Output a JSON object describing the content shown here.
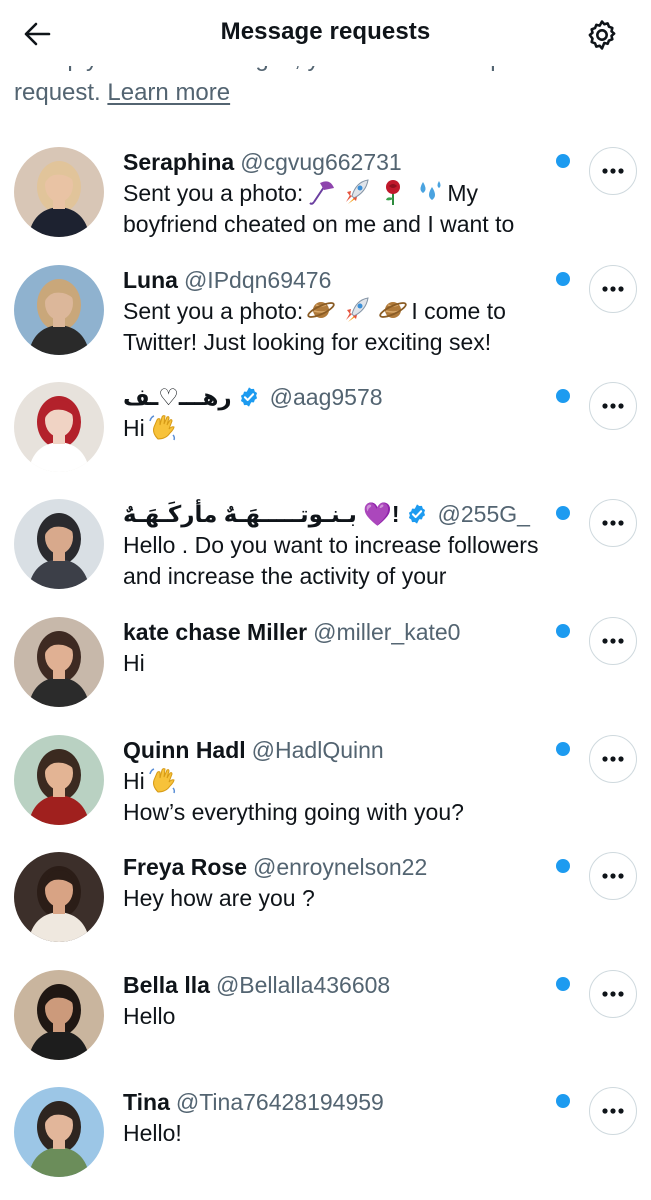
{
  "header": {
    "title": "Message requests",
    "back_icon": "arrow-left-icon",
    "settings_icon": "gear-icon"
  },
  "intro": {
    "line_cut": "To reply to their messages, you need to accept the",
    "line2": "request.",
    "learn_more": "Learn more"
  },
  "colors": {
    "accent": "#1d9bf0",
    "secondary_text": "#536471",
    "border": "#cfd9de"
  },
  "requests": [
    {
      "name": "Seraphina",
      "handle": "@cgvug662731",
      "verified": false,
      "unread": true,
      "msg1": "Sent you a photo:",
      "emojis": [
        "umbrella-emoji",
        "rocket-emoji",
        "rose-emoji",
        "sweat-droplets-emoji"
      ],
      "msg1_tail": "My",
      "msg2": "boyfriend cheated on me and I want to"
    },
    {
      "name": "Luna",
      "handle": "@IPdqn69476",
      "verified": false,
      "unread": true,
      "msg1": "Sent you a photo:",
      "emojis": [
        "ringed-planet-emoji",
        "rocket-emoji",
        "ringed-planet-emoji"
      ],
      "msg1_tail": "I come to",
      "msg2": "Twitter! Just looking for exciting sex!"
    },
    {
      "name": "رهـــ♡ـف",
      "handle": "@aag9578",
      "verified": true,
      "unread": true,
      "msg1": "Hi",
      "emojis": [
        "waving-hand-emoji"
      ]
    },
    {
      "name": "!💜 بـنـوتـــــهَـهٌ مأركَـهَـهٌ",
      "handle": "@255G_",
      "verified": true,
      "unread": true,
      "msg1": "Hello . Do you want to increase followers",
      "msg2": "and increase the activity of your"
    },
    {
      "name": "kate chase Miller",
      "handle": "@miller_kate0",
      "verified": false,
      "unread": true,
      "msg1": "Hi"
    },
    {
      "name": "Quinn Hadl",
      "handle": "@HadlQuinn",
      "verified": false,
      "unread": true,
      "msg1": "Hi",
      "emojis": [
        "waving-hand-emoji"
      ],
      "msg2": "How’s everything going with you?"
    },
    {
      "name": "Freya Rose",
      "handle": "@enroynelson22",
      "verified": false,
      "unread": true,
      "msg1": "Hey how are you ?"
    },
    {
      "name": "Bella lla",
      "handle": "@Bellalla436608",
      "verified": false,
      "unread": true,
      "msg1": "Hello"
    },
    {
      "name": "Tina",
      "handle": "@Tina76428194959",
      "verified": false,
      "unread": true,
      "msg1": "Hello!"
    }
  ]
}
